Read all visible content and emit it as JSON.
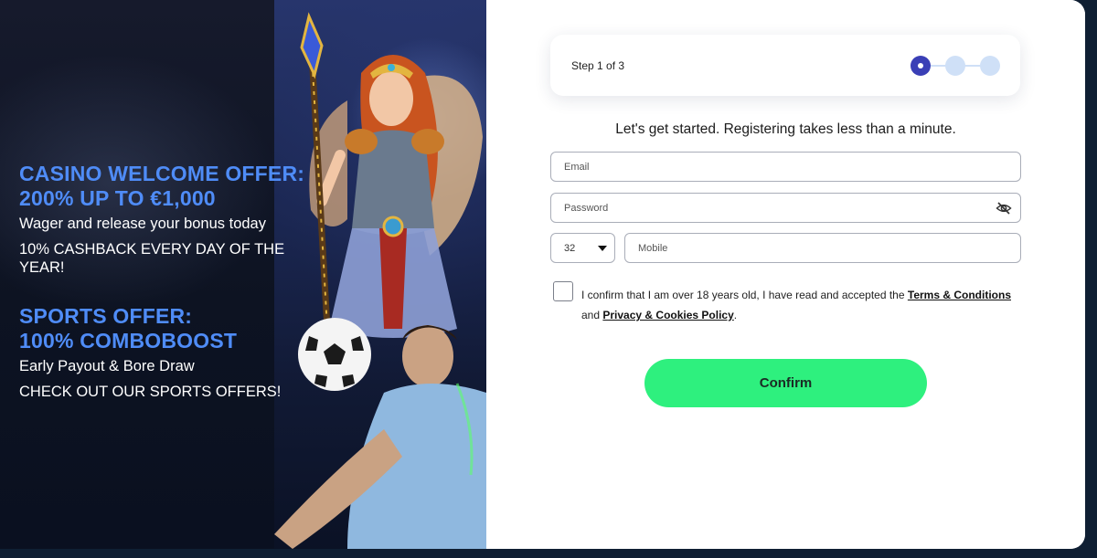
{
  "promo": {
    "casino": {
      "title_line1": "CASINO WELCOME OFFER:",
      "title_line2": "200% UP TO €1,000",
      "line1": "Wager and release your bonus today",
      "line2": "10% CASHBACK EVERY DAY OF THE YEAR!"
    },
    "sports": {
      "title_line1": "SPORTS OFFER:",
      "title_line2": "100% COMBOBOOST",
      "line1": "Early Payout & Bore Draw",
      "line2": "CHECK OUT OUR SPORTS OFFERS!"
    },
    "accent_color": "#4f8cf7"
  },
  "form": {
    "step_label": "Step 1 of 3",
    "steps_total": 3,
    "current_step": 1,
    "intro": "Let's get started. Registering takes less than a minute.",
    "email_placeholder": "Email",
    "password_placeholder": "Password",
    "phone_prefix": "32",
    "mobile_placeholder": "Mobile",
    "consent_text_1": "I confirm that I am over 18 years old, I have read and accepted the",
    "terms_link": "Terms & Conditions",
    "consent_text_2": "and",
    "privacy_link": "Privacy & Cookies Policy",
    "consent_text_3": ".",
    "confirm_label": "Confirm",
    "confirm_color": "#2ef07e",
    "active_step_color": "#3a3fb6"
  }
}
